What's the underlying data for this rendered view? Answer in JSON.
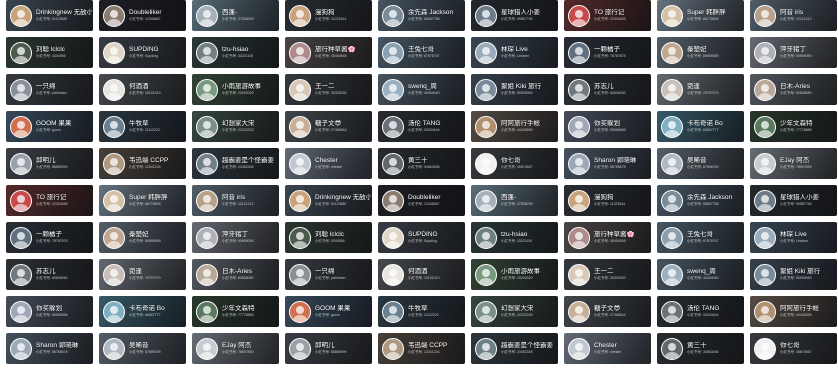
{
  "rows": [
    [
      {
        "name": "Drinkingnew 无敌小鲸",
        "sub": "小红书号: 91123580",
        "bg": "#3f4a55",
        "av": "#c7a37a"
      },
      {
        "name": "Doubleliker",
        "sub": "小红书号: 12345667",
        "bg": "#1e2026",
        "av": "#8a7b70"
      },
      {
        "name": "西蓬-",
        "sub": "小红书号: 27838299",
        "bg": "#5e7480",
        "av": "#a5b0b8"
      },
      {
        "name": "漫狗狗",
        "sub": "小红书号: 11223344",
        "bg": "#2c3036",
        "av": "#c9a27e"
      },
      {
        "name": "余先森 Jackson",
        "sub": "小红书号: 55667788",
        "bg": "#4a5a68",
        "av": "#7a8a98"
      },
      {
        "name": "星球猎人小姜",
        "sub": "小红书号: 99887766",
        "bg": "#262a30",
        "av": "#6d7b88"
      },
      {
        "name": "TO 旅行记",
        "sub": "小红书号: 22334455",
        "bg": "#5a2c2c",
        "av": "#c84a4a"
      },
      {
        "name": "Super 韩胖胖",
        "sub": "小红书号: 66778899",
        "bg": "#6b7a86",
        "av": "#d6c0a8"
      },
      {
        "name": "阿音 iris",
        "sub": "小红书号: 12121212",
        "bg": "#55636e",
        "av": "#b7a08a"
      }
    ],
    [
      {
        "name": "刘聪 lclclc",
        "sub": "小红书号: 3344556",
        "bg": "#2e3a34",
        "av": "#4b5b4e"
      },
      {
        "name": "SUPDING",
        "sub": "小红书号: Supding",
        "bg": "#3b4048",
        "av": "#e0d6c8"
      },
      {
        "name": "tzu-hsiao",
        "sub": "小红书号: 33221100",
        "bg": "#2c3a3a",
        "av": "#708080"
      },
      {
        "name": "旅行种草酱🌸",
        "sub": "小红书号: 45454545",
        "bg": "#504a4a",
        "av": "#b08a8a"
      },
      {
        "name": "王兔七哥",
        "sub": "小红书号: 67676767",
        "bg": "#4b5c6a",
        "av": "#8aa0b0"
      },
      {
        "name": "林琛 Live",
        "sub": "小红书号: Linchen",
        "bg": "#3c4a58",
        "av": "#9aacbc"
      },
      {
        "name": "一颗橘子",
        "sub": "小红书号: 78787878",
        "bg": "#2a3038",
        "av": "#607080"
      },
      {
        "name": "秦楚妃",
        "sub": "小红书号: 89898989",
        "bg": "#5a6470",
        "av": "#c0a890"
      },
      {
        "name": "萍牙猪丁",
        "sub": "小红书号: 90909090",
        "bg": "#6c7078",
        "av": "#b0b0b8"
      }
    ],
    [
      {
        "name": "一只绵",
        "sub": "小红书号: yizhimian",
        "bg": "#3a3e44",
        "av": "#8a9098"
      },
      {
        "name": "何酒酒",
        "sub": "小红书号: 10101010",
        "bg": "#4a4e52",
        "av": "#e8e4e0"
      },
      {
        "name": "小雨旅游故事",
        "sub": "小红书号: 20202020",
        "bg": "#344638",
        "av": "#7a9a80"
      },
      {
        "name": "王一二",
        "sub": "小红书号: 30303030",
        "bg": "#383c40",
        "av": "#d8c8b8"
      },
      {
        "name": "swenq_周",
        "sub": "小红书号: 40404040",
        "bg": "#4a5a66",
        "av": "#9ab0c0"
      },
      {
        "name": "絮姐 Kiki 旅行",
        "sub": "小红书号: 50505050",
        "bg": "#3a4450",
        "av": "#7a8a9a"
      },
      {
        "name": "苏志儿",
        "sub": "小红书号: 60606060",
        "bg": "#303438",
        "av": "#70787e"
      },
      {
        "name": "菀逢",
        "sub": "小红书号: 70707070",
        "bg": "#6a7078",
        "av": "#c8c0b8"
      },
      {
        "name": "日木-Aries",
        "sub": "小红书号: 80808080",
        "bg": "#585e66",
        "av": "#b8a898"
      }
    ],
    [
      {
        "name": "GOOM 果果",
        "sub": "小红书号: goom",
        "bg": "#3a4e62",
        "av": "#d07050"
      },
      {
        "name": "牛牧草",
        "sub": "小红书号: 11112222",
        "bg": "#2c3a44",
        "av": "#6a8090"
      },
      {
        "name": "幻想家大宋",
        "sub": "小红书号: 22223333",
        "bg": "#3a4a44",
        "av": "#7a9088"
      },
      {
        "name": "糖子文😎",
        "sub": "小红书号: 27356844",
        "bg": "#454a50",
        "av": "#c8b098"
      },
      {
        "name": "汤伦 TANG",
        "sub": "小红书号: 33334444",
        "bg": "#2a2e34",
        "av": "#6a7078"
      },
      {
        "name": "阿阿旅行手帐",
        "sub": "小红书号: 44445555",
        "bg": "#5a5048",
        "av": "#b09070"
      },
      {
        "name": "你买躲划",
        "sub": "小红书号: 55556666",
        "bg": "#4a5260",
        "av": "#a0a8b8"
      },
      {
        "name": "卡布奇诺 Bo",
        "sub": "小红书号: 66667777",
        "bg": "#3a6070",
        "av": "#80b0c0"
      },
      {
        "name": "少年文森特",
        "sub": "小红书号: 77778888",
        "bg": "#2a3a2e",
        "av": "#5a7a60"
      }
    ],
    [
      {
        "name": "邱明儿",
        "sub": "小红书号: 88889999",
        "bg": "#3e4248",
        "av": "#9aa0a8"
      },
      {
        "name": "韦迅端 CCPP",
        "sub": "小红书号: 12341234",
        "bg": "#4c443c",
        "av": "#b09880"
      },
      {
        "name": "越霸姜是个怪霸姜",
        "sub": "小红书号: 23452345",
        "bg": "#303a40",
        "av": "#708088"
      },
      {
        "name": "Chester",
        "sub": "小红书号: chester",
        "bg": "#6a7280",
        "av": "#c0c8d0"
      },
      {
        "name": "黄三十",
        "sub": "小红书号: 34563456",
        "bg": "#2a2e32",
        "av": "#60686e"
      },
      {
        "name": "你七哥",
        "sub": "小红书号: 45674567",
        "bg": "#3a3e42",
        "av": "#f0f0f0"
      },
      {
        "name": "Sharon 郭晓琳",
        "sub": "小红书号: 56785678",
        "bg": "#4a5664",
        "av": "#9aa8b8"
      },
      {
        "name": "吴晞音",
        "sub": "小红书号: 67896789",
        "bg": "#5a646e",
        "av": "#b0b8c0"
      },
      {
        "name": "EJay 阿杰",
        "sub": "小红书号: 78907890",
        "bg": "#6e747c",
        "av": "#c8ccd0"
      }
    ],
    [
      {
        "name": "TO 旅行记",
        "sub": "小红书号: 22334455",
        "bg": "#5a2c2c",
        "av": "#c84a4a"
      },
      {
        "name": "Super 韩胖胖",
        "sub": "小红书号: 66778899",
        "bg": "#6b7a86",
        "av": "#d6c0a8"
      },
      {
        "name": "阿音 iris",
        "sub": "小红书号: 12121212",
        "bg": "#55636e",
        "av": "#b7a08a"
      },
      {
        "name": "Drinkingnew 无敌小鲸",
        "sub": "小红书号: 91123580",
        "bg": "#3f4a55",
        "av": "#c7a37a"
      },
      {
        "name": "Doubleliker",
        "sub": "小红书号: 12345667",
        "bg": "#1e2026",
        "av": "#8a7b70"
      },
      {
        "name": "西蓬-",
        "sub": "小红书号: 27838299",
        "bg": "#5e7480",
        "av": "#a5b0b8"
      },
      {
        "name": "漫狗狗",
        "sub": "小红书号: 11223344",
        "bg": "#2c3036",
        "av": "#c9a27e"
      },
      {
        "name": "余先森 Jackson",
        "sub": "小红书号: 55667788",
        "bg": "#4a5a68",
        "av": "#7a8a98"
      },
      {
        "name": "星球猎人小姜",
        "sub": "小红书号: 99887766",
        "bg": "#262a30",
        "av": "#6d7b88"
      }
    ],
    [
      {
        "name": "一颗橘子",
        "sub": "小红书号: 78787878",
        "bg": "#2a3038",
        "av": "#607080"
      },
      {
        "name": "秦楚妃",
        "sub": "小红书号: 89898989",
        "bg": "#5a6470",
        "av": "#c0a890"
      },
      {
        "name": "萍牙猪丁",
        "sub": "小红书号: 90909090",
        "bg": "#6c7078",
        "av": "#b0b0b8"
      },
      {
        "name": "刘聪 lclclc",
        "sub": "小红书号: 3344556",
        "bg": "#2e3a34",
        "av": "#4b5b4e"
      },
      {
        "name": "SUPDING",
        "sub": "小红书号: Supding",
        "bg": "#3b4048",
        "av": "#e0d6c8"
      },
      {
        "name": "tzu-hsiao",
        "sub": "小红书号: 33221100",
        "bg": "#2c3a3a",
        "av": "#708080"
      },
      {
        "name": "旅行种草酱🌸",
        "sub": "小红书号: 45454545",
        "bg": "#504a4a",
        "av": "#b08a8a"
      },
      {
        "name": "王兔七哥",
        "sub": "小红书号: 67676767",
        "bg": "#4b5c6a",
        "av": "#8aa0b0"
      },
      {
        "name": "林琛 Live",
        "sub": "小红书号: Linchen",
        "bg": "#3c4a58",
        "av": "#9aacbc"
      }
    ],
    [
      {
        "name": "苏志儿",
        "sub": "小红书号: 60606060",
        "bg": "#303438",
        "av": "#70787e"
      },
      {
        "name": "菀逢",
        "sub": "小红书号: 70707070",
        "bg": "#6a7078",
        "av": "#c8c0b8"
      },
      {
        "name": "日木-Aries",
        "sub": "小红书号: 80808080",
        "bg": "#585e66",
        "av": "#b8a898"
      },
      {
        "name": "一只绵",
        "sub": "小红书号: yizhimian",
        "bg": "#3a3e44",
        "av": "#8a9098"
      },
      {
        "name": "何酒酒",
        "sub": "小红书号: 10101010",
        "bg": "#4a4e52",
        "av": "#e8e4e0"
      },
      {
        "name": "小雨旅游故事",
        "sub": "小红书号: 20202020",
        "bg": "#344638",
        "av": "#7a9a80"
      },
      {
        "name": "王一二",
        "sub": "小红书号: 30303030",
        "bg": "#383c40",
        "av": "#d8c8b8"
      },
      {
        "name": "swenq_周",
        "sub": "小红书号: 40404040",
        "bg": "#4a5a66",
        "av": "#9ab0c0"
      },
      {
        "name": "絮姐 Kiki 旅行",
        "sub": "小红书号: 50505050",
        "bg": "#3a4450",
        "av": "#7a8a9a"
      }
    ],
    [
      {
        "name": "你买躲划",
        "sub": "小红书号: 55556666",
        "bg": "#4a5260",
        "av": "#a0a8b8"
      },
      {
        "name": "卡布奇诺 Bo",
        "sub": "小红书号: 66667777",
        "bg": "#3a6070",
        "av": "#80b0c0"
      },
      {
        "name": "少年文森特",
        "sub": "小红书号: 77778888",
        "bg": "#2a3a2e",
        "av": "#5a7a60"
      },
      {
        "name": "GOOM 果果",
        "sub": "小红书号: goom",
        "bg": "#3a4e62",
        "av": "#d07050"
      },
      {
        "name": "牛牧草",
        "sub": "小红书号: 11112222",
        "bg": "#2c3a44",
        "av": "#6a8090"
      },
      {
        "name": "幻想家大宋",
        "sub": "小红书号: 22223333",
        "bg": "#3a4a44",
        "av": "#7a9088"
      },
      {
        "name": "糖子文😎",
        "sub": "小红书号: 27356844",
        "bg": "#454a50",
        "av": "#c8b098"
      },
      {
        "name": "汤伦 TANG",
        "sub": "小红书号: 33334444",
        "bg": "#2a2e34",
        "av": "#6a7078"
      },
      {
        "name": "阿阿旅行手帐",
        "sub": "小红书号: 44445555",
        "bg": "#5a5048",
        "av": "#b09070"
      }
    ],
    [
      {
        "name": "Sharon 郭晓琳",
        "sub": "小红书号: 56785678",
        "bg": "#4a5664",
        "av": "#9aa8b8"
      },
      {
        "name": "吴晞音",
        "sub": "小红书号: 67896789",
        "bg": "#5a646e",
        "av": "#b0b8c0"
      },
      {
        "name": "EJay 阿杰",
        "sub": "小红书号: 78907890",
        "bg": "#6e747c",
        "av": "#c8ccd0"
      },
      {
        "name": "邱明儿",
        "sub": "小红书号: 88889999",
        "bg": "#3e4248",
        "av": "#9aa0a8"
      },
      {
        "name": "韦迅端 CCPP",
        "sub": "小红书号: 12341234",
        "bg": "#4c443c",
        "av": "#b09880"
      },
      {
        "name": "越霸姜是个怪霸姜",
        "sub": "小红书号: 23452345",
        "bg": "#303a40",
        "av": "#708088"
      },
      {
        "name": "Chester",
        "sub": "小红书号: chester",
        "bg": "#6a7280",
        "av": "#c0c8d0"
      },
      {
        "name": "黄三十",
        "sub": "小红书号: 34563456",
        "bg": "#2a2e32",
        "av": "#60686e"
      },
      {
        "name": "你七哥",
        "sub": "小红书号: 45674567",
        "bg": "#3a3e42",
        "av": "#f0f0f0"
      }
    ]
  ]
}
